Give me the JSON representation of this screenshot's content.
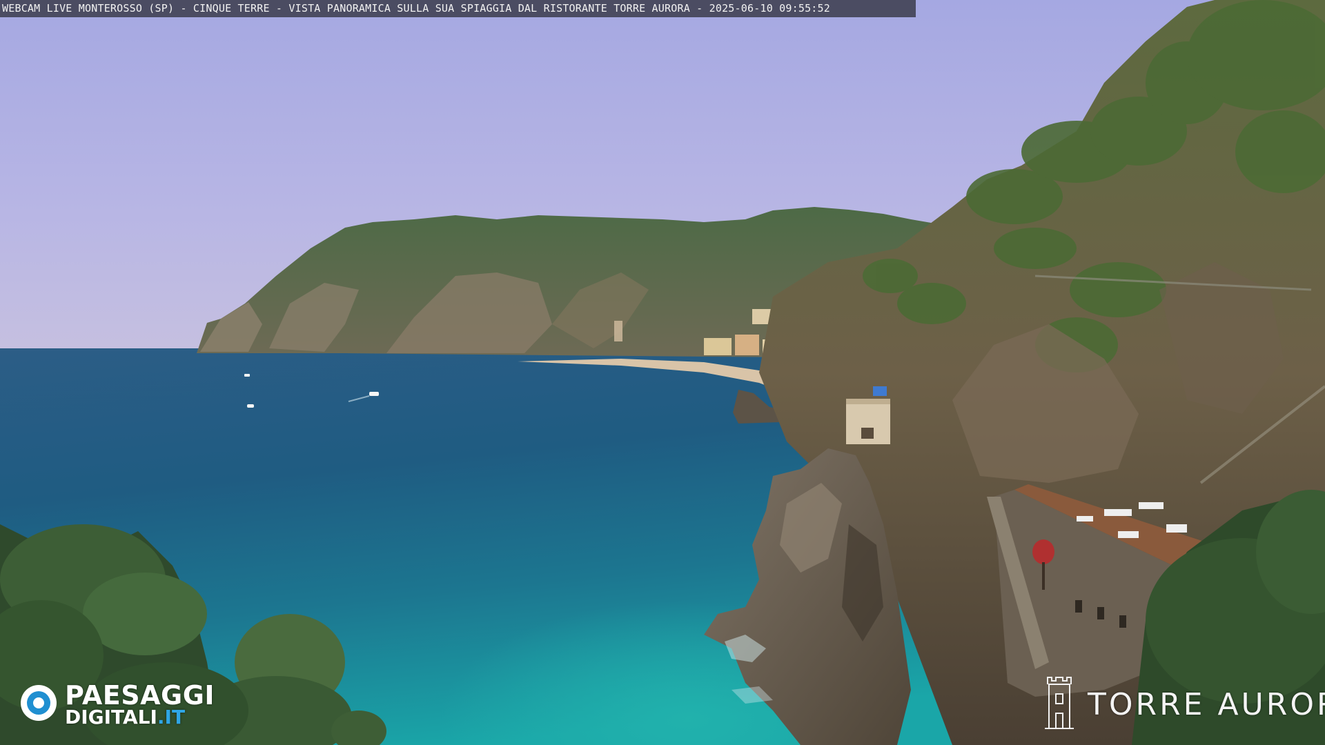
{
  "webcam": {
    "caption": "WEBCAM LIVE MONTEROSSO (SP) - CINQUE TERRE - VISTA PANORAMICA SULLA SUA SPIAGGIA DAL RISTORANTE TORRE AURORA - 2025-06-10 09:55:52"
  },
  "watermark_left": {
    "line1": "PAESAGGI",
    "line2_main": "DIGITALI",
    "line2_accent": ".IT",
    "accent_color": "#2fa6e6",
    "icon": "eye-logo-icon"
  },
  "watermark_right": {
    "text": "TORRE AURORA",
    "icon": "tower-icon"
  },
  "colors": {
    "sky_top": "#a7a9e0",
    "sky_horizon": "#c3bee0",
    "sea_deep": "#1d4f78",
    "sea_shallow": "#1e9aa5",
    "hills": "#3f5a3a",
    "cliffs": "#6a5a4a"
  }
}
